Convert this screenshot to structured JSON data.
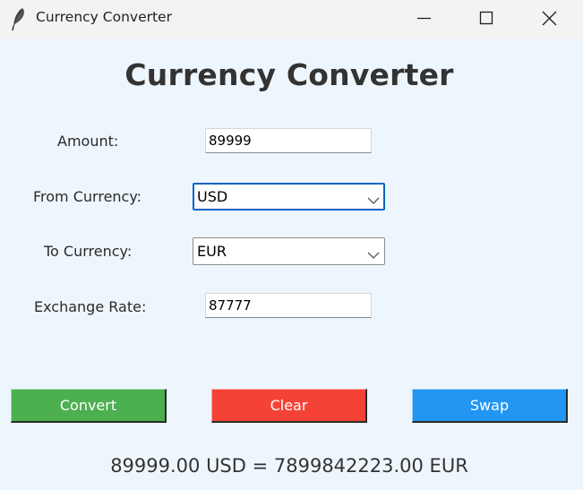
{
  "window": {
    "title": "Currency Converter",
    "icon": "feather-icon",
    "controls": [
      "minimize-icon",
      "maximize-icon",
      "close-icon"
    ]
  },
  "heading": "Currency Converter",
  "form": {
    "amount": {
      "label": "Amount:",
      "value": "89999"
    },
    "from_currency": {
      "label": "From Currency:",
      "value": "USD"
    },
    "to_currency": {
      "label": "To Currency:",
      "value": "EUR"
    },
    "exchange_rate": {
      "label": "Exchange Rate:",
      "value": "87777"
    }
  },
  "buttons": {
    "convert": {
      "label": "Convert",
      "color": "#4caf50"
    },
    "clear": {
      "label": "Clear",
      "color": "#f44336"
    },
    "swap": {
      "label": "Swap",
      "color": "#2196f3"
    }
  },
  "result": "89999.00 USD = 7899842223.00 EUR",
  "colors": {
    "background": "#eef6fd",
    "focus": "#0a64c4"
  }
}
